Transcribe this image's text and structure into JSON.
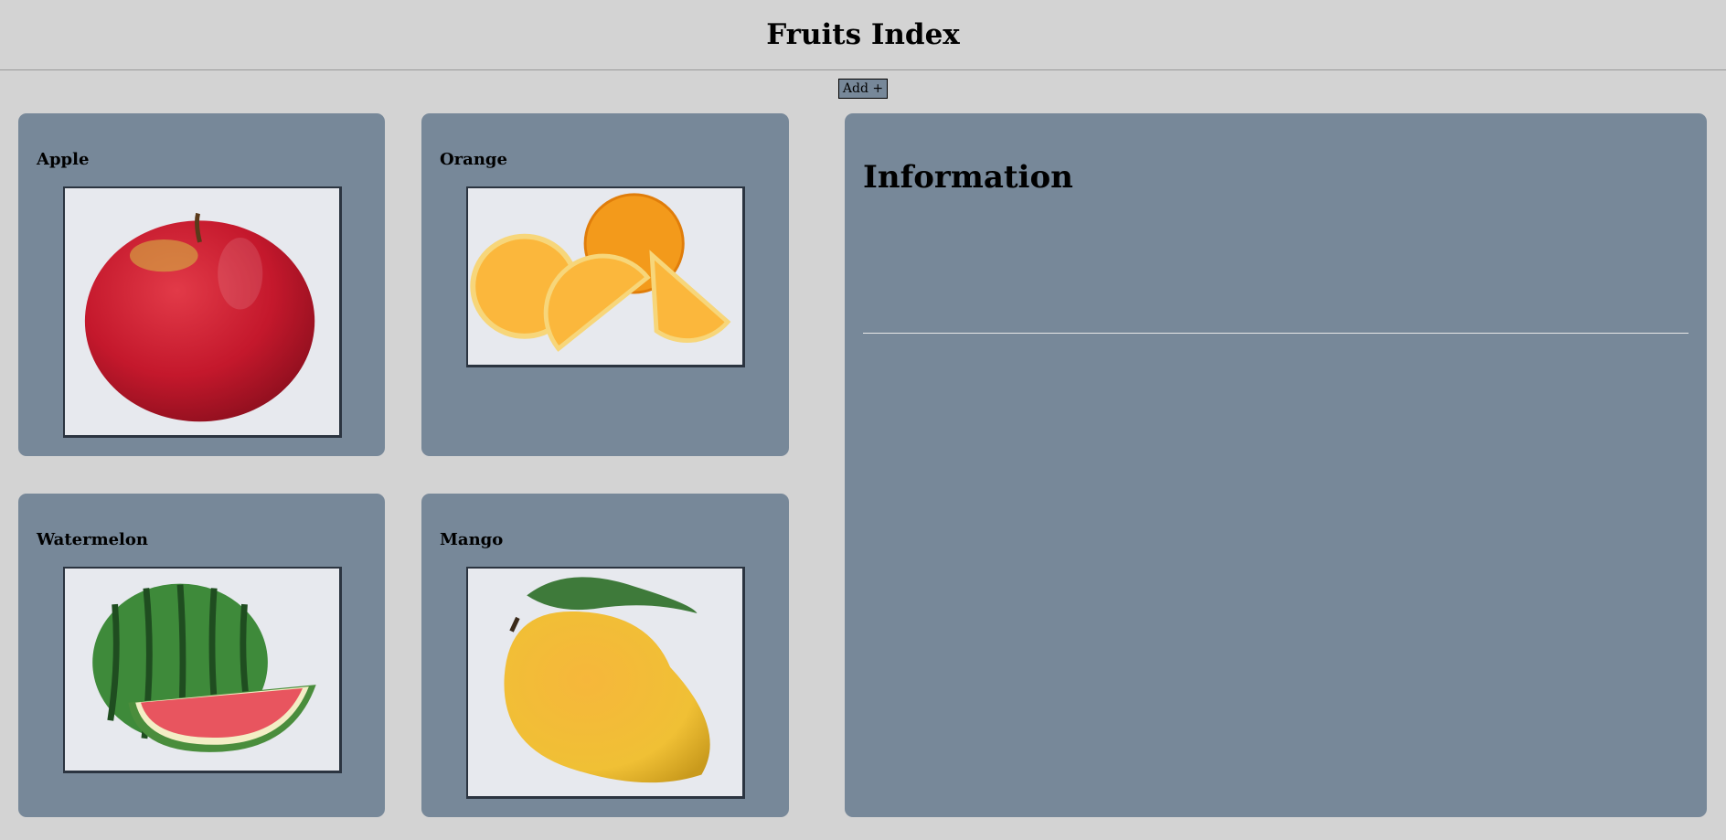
{
  "header": {
    "title": "Fruits Index"
  },
  "toolbar": {
    "add_label": "Add +"
  },
  "fruits": [
    {
      "name": "Apple"
    },
    {
      "name": "Orange"
    },
    {
      "name": "Watermelon"
    },
    {
      "name": "Mango"
    }
  ],
  "info_panel": {
    "title": "Information"
  },
  "colors": {
    "page_background": "#d3d3d3",
    "card_background": "#778899",
    "photo_background": "#e7e9ee"
  }
}
